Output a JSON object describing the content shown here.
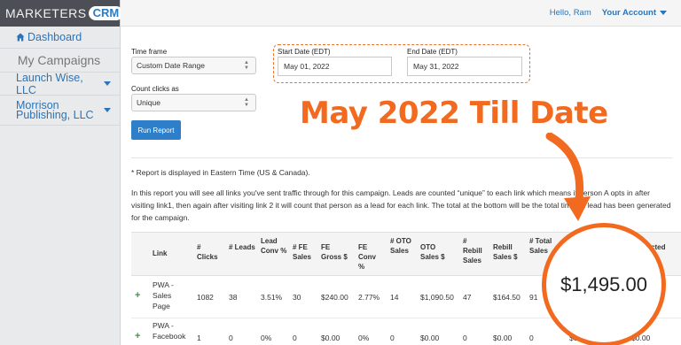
{
  "brand": {
    "logo_word": "MARKETERS",
    "logo_badge": "CRM"
  },
  "sidebar": {
    "dashboard": "Dashboard",
    "campaigns": "My Campaigns",
    "clients": [
      "Launch Wise, LLC",
      "Morrison Publishing, LLC"
    ]
  },
  "topbar": {
    "greeting": "Hello, Ram",
    "account": "Your Account"
  },
  "form": {
    "timeframe_label": "Time frame",
    "timeframe_value": "Custom Date Range",
    "count_label": "Count clicks as",
    "count_value": "Unique",
    "start_label": "Start Date (EDT)",
    "start_value": "May 01, 2022",
    "end_label": "End Date (EDT)",
    "end_value": "May 31, 2022",
    "run_button": "Run Report"
  },
  "notes": {
    "timezone": "* Report is displayed in Eastern Time (US & Canada).",
    "description": "In this report you will see all links you've sent traffic through for this campaign. Leads are counted “unique” to each link which means if person A opts in after visiting link1, then again after visiting link 2 it will count that person as a lead for each link. The total at the bottom will be the total times a lead has been generated for the campaign."
  },
  "table": {
    "headers": {
      "link": "Link",
      "clicks": "# Clicks",
      "leads": "# Leads",
      "lead_conv": "Lead Conv %",
      "fe_sales": "# FE Sales",
      "fe_gross": "FE Gross $",
      "fe_conv": "FE Conv %",
      "oto_sales": "# OTO Sales",
      "oto_sales_amt": "OTO Sales $",
      "rebill_sales": "# Rebill Sales",
      "rebill_amt": "Rebill Sales $",
      "total_sales": "# Total Sales",
      "deducted": "Deducted"
    },
    "rows": [
      {
        "link": "PWA - Sales Page",
        "clicks": "1082",
        "leads": "38",
        "lead_conv": "3.51%",
        "fe_sales": "30",
        "fe_gross": "$240.00",
        "fe_conv": "2.77%",
        "oto_sales": "14",
        "oto_sales_amt": "$1,090.50",
        "rebill_sales": "47",
        "rebill_amt": "$164.50",
        "total_sales": "91",
        "gross": "",
        "deducted": ""
      },
      {
        "link": "PWA - Facebook",
        "clicks": "1",
        "leads": "0",
        "lead_conv": "0%",
        "fe_sales": "0",
        "fe_gross": "$0.00",
        "fe_conv": "0%",
        "oto_sales": "0",
        "oto_sales_amt": "$0.00",
        "rebill_sales": "0",
        "rebill_amt": "$0.00",
        "total_sales": "0",
        "gross": "$0.00",
        "deducted": "$0.00"
      }
    ]
  },
  "overlay": {
    "headline": "May 2022 Till Date",
    "highlight_value": "$1,495.00",
    "accent_color": "#f26a1f"
  }
}
